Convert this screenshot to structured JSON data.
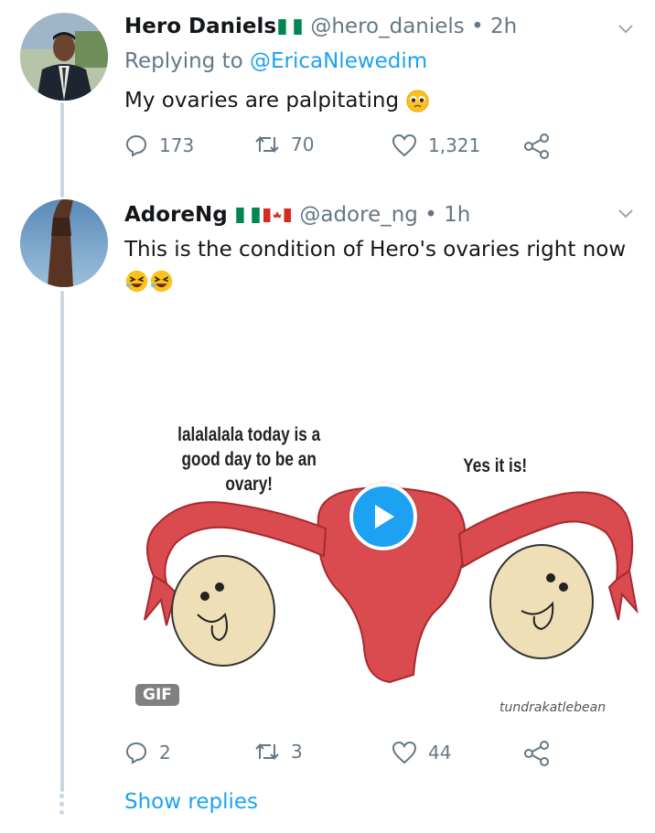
{
  "tweet1": {
    "name": "Hero Daniels",
    "handle": "@hero_daniels",
    "time": "2h",
    "replying_prefix": "Replying to",
    "replying_to": "@EricaNlewedim",
    "text": "My ovaries are palpitating",
    "replies": "173",
    "retweets": "70",
    "likes": "1,321"
  },
  "tweet2": {
    "name": "AdoreNg",
    "handle": "@adore_ng",
    "time": "1h",
    "text": "This is the condition of Hero's ovaries right now",
    "media": {
      "badge": "GIF",
      "caption_left": "lalalalala today is a good day to be an ovary!",
      "caption_left_lines": [
        "lalalalala today is a",
        "good day to be an",
        "ovary!"
      ],
      "caption_right": "Yes it is!",
      "signature": "tundrakatlebean"
    },
    "replies": "2",
    "retweets": "3",
    "likes": "44"
  },
  "show_replies": "Show replies",
  "colors": {
    "accent": "#1da1f2",
    "muted": "#657786",
    "uterus": "#d94b4f",
    "ovary": "#eedfb7"
  }
}
